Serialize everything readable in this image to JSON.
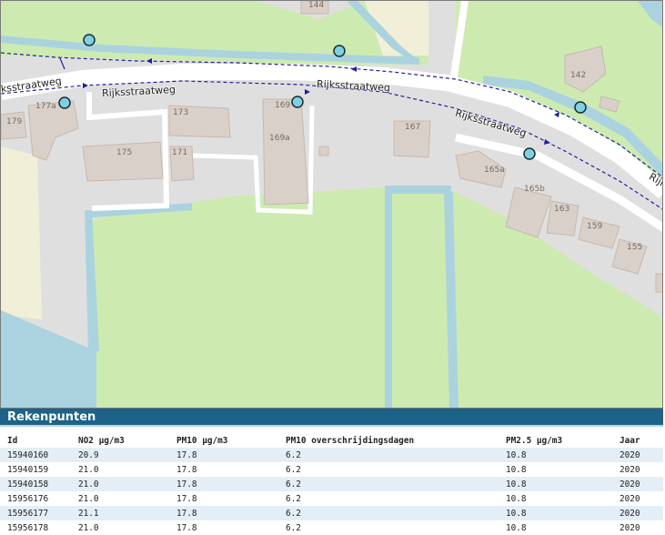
{
  "map": {
    "road_name_labels": [
      "Rijksstraatweg",
      "Rijksstraatweg",
      "Rijksstraatweg",
      "Rijksstraatweg",
      "Rijksstraatweg"
    ],
    "house_numbers": [
      "144",
      "142",
      "177a",
      "179",
      "173",
      "169",
      "169a",
      "167",
      "175",
      "171",
      "165a",
      "165b",
      "163",
      "159",
      "155"
    ],
    "colors": {
      "land": "#e0dfdf",
      "grass": "#cdebb0",
      "water": "#aad3df",
      "building": "#d9d0c9",
      "road": "#ffffff",
      "route": "#1f1f9f",
      "calc_point": "#7ed1e3"
    },
    "markers_count_visible": 7
  },
  "panel": {
    "title": "Rekenpunten",
    "columns": [
      "Id",
      "NO2 µg/m3",
      "PM10 µg/m3",
      "PM10 overschrijdingsdagen",
      "PM2.5 µg/m3",
      "Jaar"
    ],
    "rows": [
      [
        "15940160",
        "20.9",
        "17.8",
        "6.2",
        "10.8",
        "2020"
      ],
      [
        "15940159",
        "21.0",
        "17.8",
        "6.2",
        "10.8",
        "2020"
      ],
      [
        "15940158",
        "21.0",
        "17.8",
        "6.2",
        "10.8",
        "2020"
      ],
      [
        "15956176",
        "21.0",
        "17.8",
        "6.2",
        "10.8",
        "2020"
      ],
      [
        "15956177",
        "21.1",
        "17.8",
        "6.2",
        "10.8",
        "2020"
      ],
      [
        "15956178",
        "21.0",
        "17.8",
        "6.2",
        "10.8",
        "2020"
      ]
    ]
  }
}
